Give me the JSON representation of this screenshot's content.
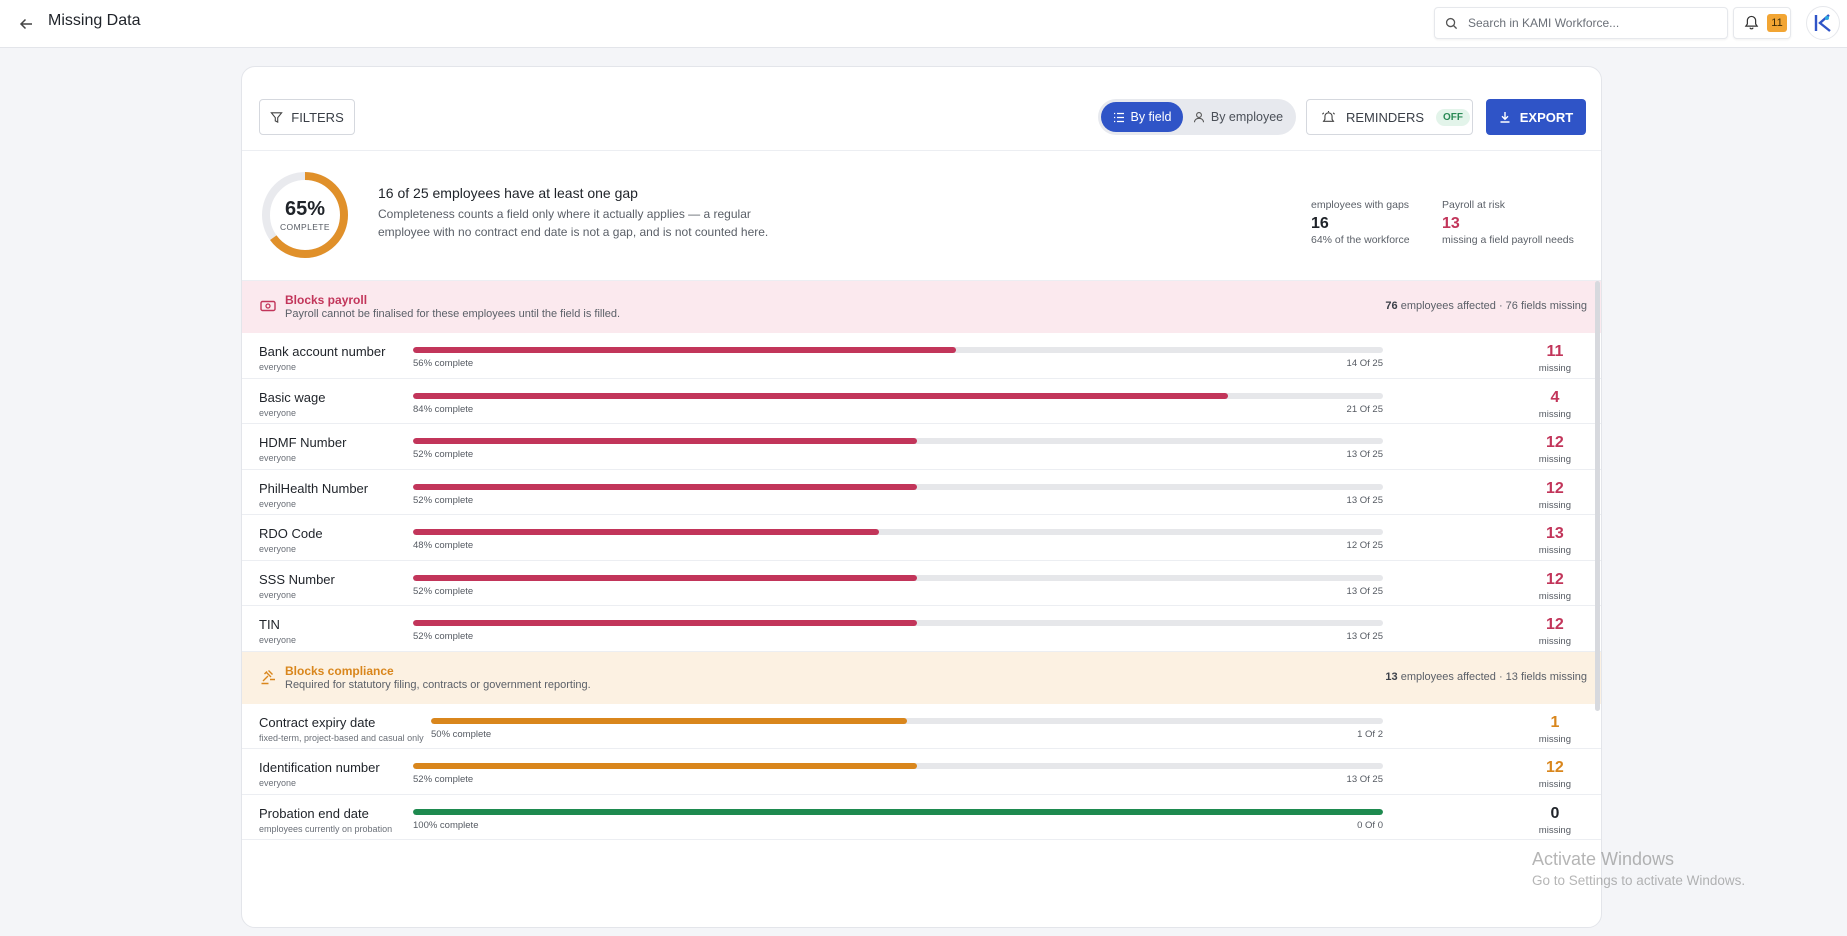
{
  "header": {
    "title": "Missing Data",
    "search_placeholder": "Search in KAMI Workforce...",
    "notification_count": "11"
  },
  "toolbar": {
    "filters_label": "FILTERS",
    "view_by_field": "By field",
    "view_by_employee": "By employee",
    "reminders_label": "REMINDERS",
    "reminders_state": "OFF",
    "export_label": "EXPORT"
  },
  "summary": {
    "completion_percent": 65,
    "completion_label": "65%",
    "completion_sub": "COMPLETE",
    "headline": "16 of 25 employees have at least one gap",
    "description": "Completeness counts a field only where it actually applies — a regular employee with no contract end date is not a gap, and is not counted here.",
    "stats": [
      {
        "label": "employees with gaps",
        "value": "16",
        "note": "64% of the workforce"
      },
      {
        "label": "Payroll at risk",
        "value": "13",
        "note": "missing a field payroll needs"
      }
    ]
  },
  "groups": [
    {
      "title": "Blocks payroll",
      "description": "Payroll cannot be finalised for these employees until the field is filled.",
      "employees_affected": "76",
      "summary_suffix": " employees affected · 76 fields missing",
      "color": "#c2355a",
      "background": "#fbe9ee",
      "rows": [
        {
          "name": "Bank account number",
          "scope": "everyone",
          "percent": 56,
          "percent_text": "56% complete",
          "count_text": "14 Of 25",
          "missing": "11",
          "missing_label": "missing"
        },
        {
          "name": "Basic wage",
          "scope": "everyone",
          "percent": 84,
          "percent_text": "84% complete",
          "count_text": "21 Of 25",
          "missing": "4",
          "missing_label": "missing"
        },
        {
          "name": "HDMF Number",
          "scope": "everyone",
          "percent": 52,
          "percent_text": "52% complete",
          "count_text": "13 Of 25",
          "missing": "12",
          "missing_label": "missing"
        },
        {
          "name": "PhilHealth Number",
          "scope": "everyone",
          "percent": 52,
          "percent_text": "52% complete",
          "count_text": "13 Of 25",
          "missing": "12",
          "missing_label": "missing"
        },
        {
          "name": "RDO Code",
          "scope": "everyone",
          "percent": 48,
          "percent_text": "48% complete",
          "count_text": "12 Of 25",
          "missing": "13",
          "missing_label": "missing"
        },
        {
          "name": "SSS Number",
          "scope": "everyone",
          "percent": 52,
          "percent_text": "52% complete",
          "count_text": "13 Of 25",
          "missing": "12",
          "missing_label": "missing"
        },
        {
          "name": "TIN",
          "scope": "everyone",
          "percent": 52,
          "percent_text": "52% complete",
          "count_text": "13 Of 25",
          "missing": "12",
          "missing_label": "missing"
        }
      ]
    },
    {
      "title": "Blocks compliance",
      "description": "Required for statutory filing, contracts or government reporting.",
      "employees_affected": "13",
      "summary_suffix": " employees affected · 13 fields missing",
      "color": "#d9861c",
      "background": "#fcf1e2",
      "rows": [
        {
          "name": "Contract expiry date",
          "scope": "fixed-term, project-based and casual only",
          "percent": 50,
          "percent_text": "50% complete",
          "count_text": "1 Of 2",
          "missing": "1",
          "missing_label": "missing"
        },
        {
          "name": "Identification number",
          "scope": "everyone",
          "percent": 52,
          "percent_text": "52% complete",
          "count_text": "13 Of 25",
          "missing": "12",
          "missing_label": "missing"
        },
        {
          "name": "Probation end date",
          "scope": "employees currently on probation",
          "percent": 100,
          "percent_text": "100% complete",
          "count_text": "0 Of 0",
          "missing": "0",
          "missing_label": "missing",
          "complete_color": "#1e8a4f"
        }
      ]
    }
  ],
  "colors": {
    "primary": "#2f54c7",
    "payroll_red": "#c2355a",
    "compliance_orange": "#d9861c",
    "complete_green": "#1e8a4f",
    "donut_orange": "#e0902a"
  },
  "watermark": {
    "line1": "Activate Windows",
    "line2": "Go to Settings to activate Windows."
  }
}
